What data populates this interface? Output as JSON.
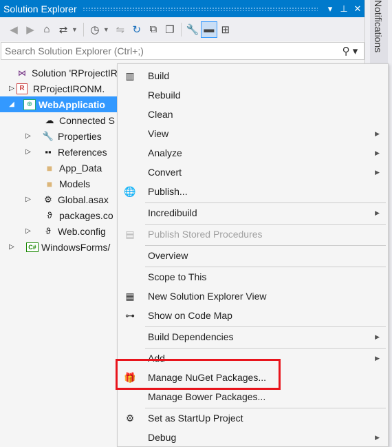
{
  "window": {
    "title": "Solution Explorer",
    "pin_icon": "pin-icon",
    "close_icon": "close-icon",
    "dropdown_icon": "caret-down-icon"
  },
  "notifications": {
    "label": "Notifications"
  },
  "toolbar": {
    "icons": [
      "back-icon",
      "forward-icon",
      "home-icon",
      "switch-views-icon",
      "pending-changes-filter-icon",
      "sync-icon",
      "refresh-icon",
      "collapse-all-icon",
      "show-all-files-icon",
      "properties-icon",
      "preview-selected-icon",
      "class-view-icon"
    ]
  },
  "search": {
    "placeholder": "Search Solution Explorer (Ctrl+;)",
    "value": ""
  },
  "tree": {
    "solution": "Solution 'RProjectIR",
    "project_r": "RProjectIRONM.",
    "project_web": "WebApplicatio",
    "connected": "Connected S",
    "properties": "Properties",
    "references": "References",
    "app_data": "App_Data",
    "models": "Models",
    "global": "Global.asax",
    "packages": "packages.co",
    "webconfig": "Web.config",
    "winforms": "WindowsForms/"
  },
  "menu": {
    "build": "Build",
    "rebuild": "Rebuild",
    "clean": "Clean",
    "view": "View",
    "analyze": "Analyze",
    "convert": "Convert",
    "publish": "Publish...",
    "incredibuild": "Incredibuild",
    "publish_sp": "Publish Stored Procedures",
    "overview": "Overview",
    "scope": "Scope to This",
    "new_view": "New Solution Explorer View",
    "code_map": "Show on Code Map",
    "build_deps": "Build Dependencies",
    "add": "Add",
    "nuget": "Manage NuGet Packages...",
    "bower": "Manage Bower Packages...",
    "startup": "Set as StartUp Project",
    "debug": "Debug"
  },
  "colors": {
    "accent": "#007acc",
    "selection": "#3399ff",
    "highlight_box": "#e8141c"
  }
}
